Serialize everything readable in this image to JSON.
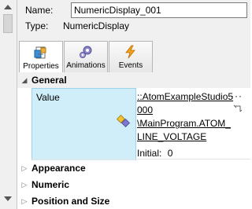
{
  "header": {
    "name_label": "Name:",
    "name_value": "NumericDisplay_001",
    "type_label": "Type:",
    "type_value": "NumericDisplay"
  },
  "tabs": [
    {
      "label": "Properties",
      "icon": "properties-icon",
      "active": true
    },
    {
      "label": "Animations",
      "icon": "animations-icon",
      "active": false
    },
    {
      "label": "Events",
      "icon": "events-icon",
      "active": false
    }
  ],
  "categories": {
    "general": "General",
    "appearance": "Appearance",
    "numeric": "Numeric",
    "position_size": "Position and Size"
  },
  "property": {
    "label": "Value",
    "binding_lines": [
      "::AtomExampleStudio5",
      "000",
      "\\MainProgram.ATOM_",
      "LINE_VOLTAGE"
    ],
    "initial_label": "Initial:",
    "initial_value": "0",
    "more_button": "···"
  },
  "colors": {
    "accent_cell": "#cfeef9",
    "panel_bg": "#f0f0f0"
  }
}
